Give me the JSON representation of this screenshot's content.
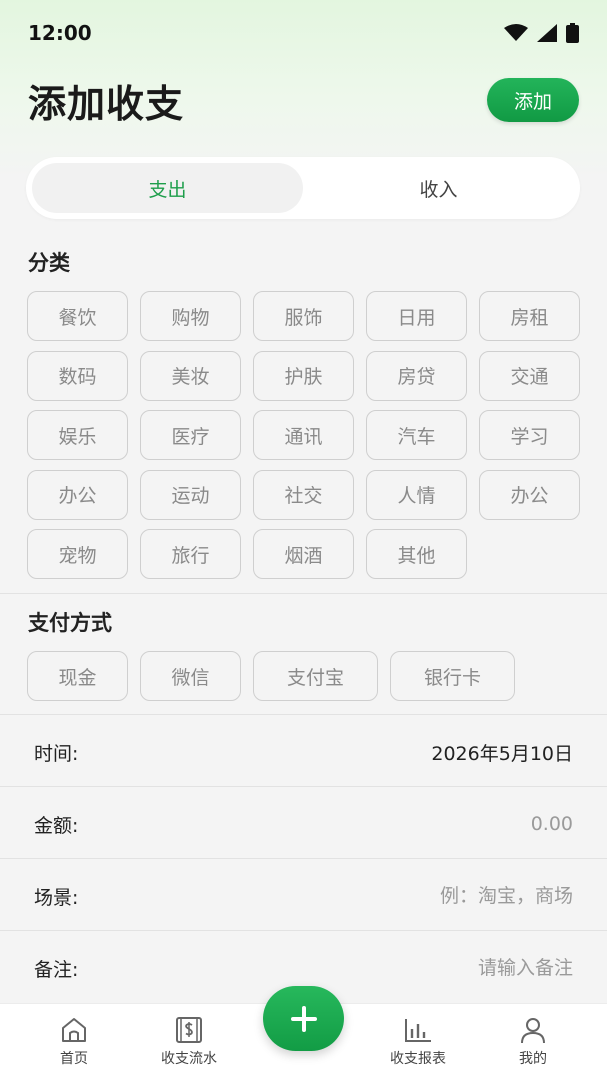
{
  "status": {
    "time": "12:00"
  },
  "header": {
    "title": "添加收支",
    "add_label": "添加"
  },
  "tabs": [
    {
      "label": "支出",
      "active": true
    },
    {
      "label": "收入",
      "active": false
    }
  ],
  "category": {
    "title": "分类",
    "items": [
      "餐饮",
      "购物",
      "服饰",
      "日用",
      "房租",
      "数码",
      "美妆",
      "护肤",
      "房贷",
      "交通",
      "娱乐",
      "医疗",
      "通讯",
      "汽车",
      "学习",
      "办公",
      "运动",
      "社交",
      "人情",
      "办公",
      "宠物",
      "旅行",
      "烟酒",
      "其他"
    ]
  },
  "payment": {
    "title": "支付方式",
    "items": [
      "现金",
      "微信",
      "支付宝",
      "银行卡"
    ]
  },
  "form": {
    "time_label": "时间:",
    "time_value": "2026年5月10日",
    "amount_label": "金额:",
    "amount_placeholder": "0.00",
    "scene_label": "场景:",
    "scene_placeholder": "例：淘宝，商场",
    "note_label": "备注:",
    "note_placeholder": "请输入备注"
  },
  "nav": {
    "home": "首页",
    "flow": "收支流水",
    "report": "收支报表",
    "mine": "我的"
  },
  "colors": {
    "accent": "#1e9e4b",
    "chip_border": "#cfcfcf"
  }
}
